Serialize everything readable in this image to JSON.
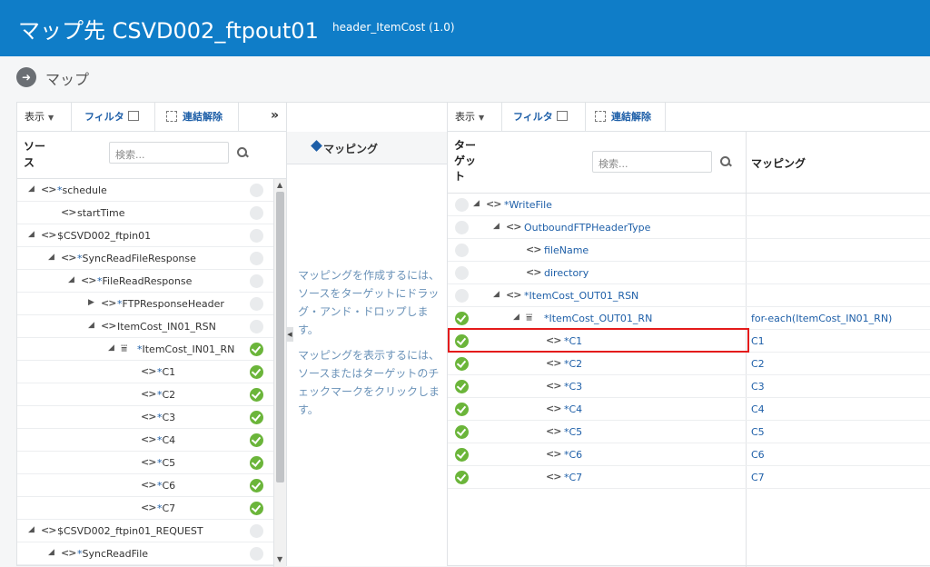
{
  "header": {
    "title": "マップ先 CSVD002_ftpout01",
    "subtitle": "header_ItemCost (1.0)"
  },
  "page": {
    "label": "マップ"
  },
  "source_panel": {
    "toolbar": {
      "view": "表示",
      "filter": "フィルタ",
      "unlink": "連結解除",
      "expand": "»"
    },
    "column_header": "ソース",
    "search_placeholder": "検索...",
    "rows": [
      {
        "prefix": "",
        "name": "schedule",
        "star": "*"
      },
      {
        "prefix": "",
        "name": "startTime",
        "star": ""
      },
      {
        "prefix": "",
        "name": "$CSVD002_ftpin01",
        "star": ""
      },
      {
        "prefix": "",
        "name": "SyncReadFileResponse",
        "star": "*"
      },
      {
        "prefix": "",
        "name": "FileReadResponse",
        "star": "*"
      },
      {
        "prefix": "",
        "name": "FTPResponseHeader",
        "star": "*"
      },
      {
        "prefix": "",
        "name": "ItemCost_IN01_RSN",
        "star": ""
      },
      {
        "prefix": "",
        "name": "ItemCost_IN01_RN",
        "star": "*"
      },
      {
        "prefix": "",
        "name": "C1",
        "star": "*"
      },
      {
        "prefix": "",
        "name": "C2",
        "star": "*"
      },
      {
        "prefix": "",
        "name": "C3",
        "star": "*"
      },
      {
        "prefix": "",
        "name": "C4",
        "star": "*"
      },
      {
        "prefix": "",
        "name": "C5",
        "star": "*"
      },
      {
        "prefix": "",
        "name": "C6",
        "star": "*"
      },
      {
        "prefix": "",
        "name": "C7",
        "star": "*"
      },
      {
        "prefix": "",
        "name": "$CSVD002_ftpin01_REQUEST",
        "star": ""
      },
      {
        "prefix": "",
        "name": "SyncReadFile",
        "star": "*"
      }
    ]
  },
  "mapping_panel": {
    "title": "マッピング",
    "help_1": "マッピングを作成するには、ソースをターゲットにドラッグ・アンド・ドロップします。",
    "help_2": "マッピングを表示するには、ソースまたはターゲットのチェックマークをクリックします。"
  },
  "target_panel": {
    "toolbar": {
      "view": "表示",
      "filter": "フィルタ",
      "unlink": "連結解除"
    },
    "column_header": "ターゲット",
    "mapping_header": "マッピング",
    "search_placeholder": "検索...",
    "rows": [
      {
        "name": "WriteFile",
        "star": "*",
        "mapping": ""
      },
      {
        "name": "OutboundFTPHeaderType",
        "star": "",
        "mapping": ""
      },
      {
        "name": "fileName",
        "star": "",
        "mapping": ""
      },
      {
        "name": "directory",
        "star": "",
        "mapping": ""
      },
      {
        "name": "ItemCost_OUT01_RSN",
        "star": "*",
        "mapping": ""
      },
      {
        "name": "ItemCost_OUT01_RN",
        "star": "*",
        "mapping": "for-each(ItemCost_IN01_RN)"
      },
      {
        "name": "C1",
        "star": "*",
        "mapping": "C1"
      },
      {
        "name": "C2",
        "star": "*",
        "mapping": "C2"
      },
      {
        "name": "C3",
        "star": "*",
        "mapping": "C3"
      },
      {
        "name": "C4",
        "star": "*",
        "mapping": "C4"
      },
      {
        "name": "C5",
        "star": "*",
        "mapping": "C5"
      },
      {
        "name": "C6",
        "star": "*",
        "mapping": "C6"
      },
      {
        "name": "C7",
        "star": "*",
        "mapping": "C7"
      }
    ]
  },
  "colors": {
    "brand": "#0f7dc8",
    "link": "#1e5fa8",
    "check": "#6bb53a",
    "highlight": "#e41b1b"
  }
}
